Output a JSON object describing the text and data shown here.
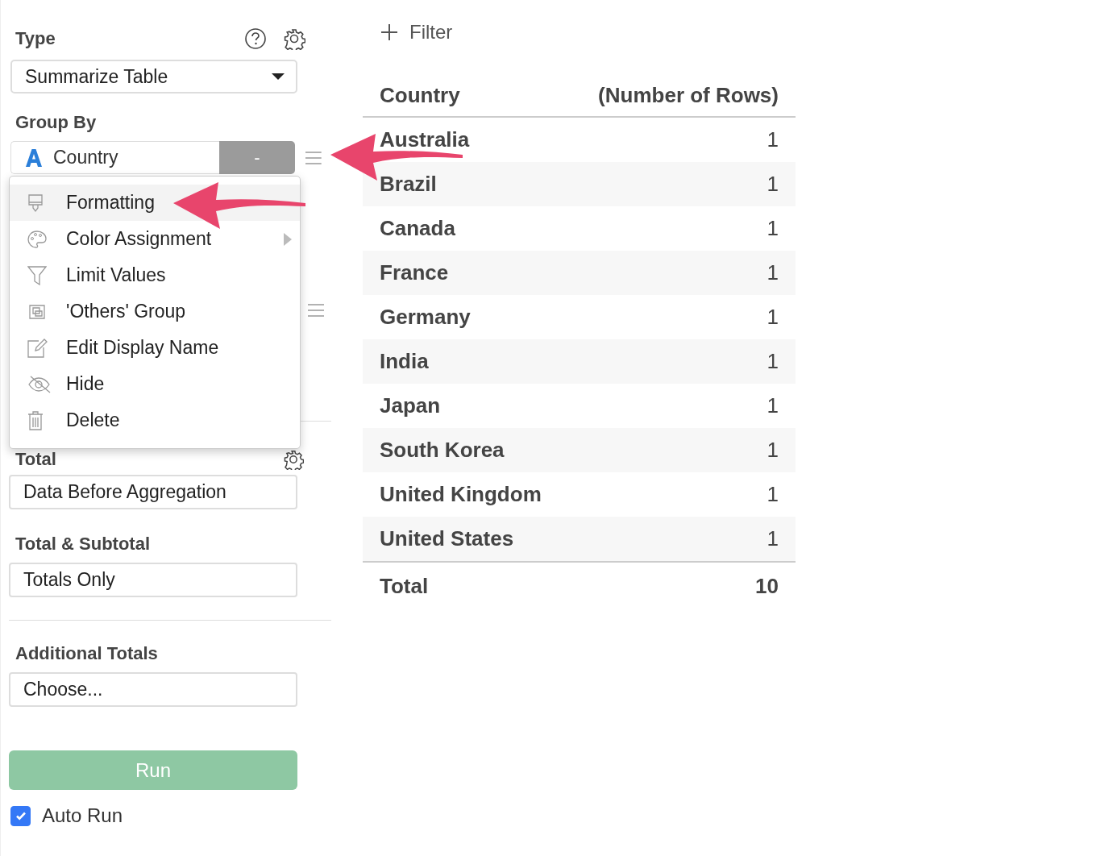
{
  "sidebar": {
    "type_label": "Type",
    "type_select": {
      "value": "Summarize Table"
    },
    "group_by_label": "Group By",
    "group_by": {
      "column": "Country",
      "button": "-"
    },
    "menu": {
      "items": [
        {
          "label": "Formatting",
          "selected": true,
          "submenu": false
        },
        {
          "label": "Color Assignment",
          "selected": false,
          "submenu": true
        },
        {
          "label": "Limit Values",
          "selected": false,
          "submenu": false
        },
        {
          "label": "'Others' Group",
          "selected": false,
          "submenu": false
        },
        {
          "label": "Edit Display Name",
          "selected": false,
          "submenu": false
        },
        {
          "label": "Hide",
          "selected": false,
          "submenu": false
        },
        {
          "label": "Delete",
          "selected": false,
          "submenu": false
        }
      ]
    },
    "total_label": "Total",
    "total_select": {
      "value": "Data Before Aggregation"
    },
    "subtotal_label": "Total & Subtotal",
    "subtotal_select": {
      "value": "Totals Only"
    },
    "additional_label": "Additional Totals",
    "additional_select": {
      "placeholder": "Choose..."
    },
    "run_button": "Run",
    "auto_run": {
      "label": "Auto Run",
      "checked": true
    }
  },
  "filter_button": "Filter",
  "table": {
    "columns": [
      "Country",
      "(Number of Rows)"
    ],
    "rows": [
      [
        "Australia",
        "1"
      ],
      [
        "Brazil",
        "1"
      ],
      [
        "Canada",
        "1"
      ],
      [
        "France",
        "1"
      ],
      [
        "Germany",
        "1"
      ],
      [
        "India",
        "1"
      ],
      [
        "Japan",
        "1"
      ],
      [
        "South Korea",
        "1"
      ],
      [
        "United Kingdom",
        "1"
      ],
      [
        "United States",
        "1"
      ]
    ],
    "total": [
      "Total",
      "10"
    ]
  }
}
